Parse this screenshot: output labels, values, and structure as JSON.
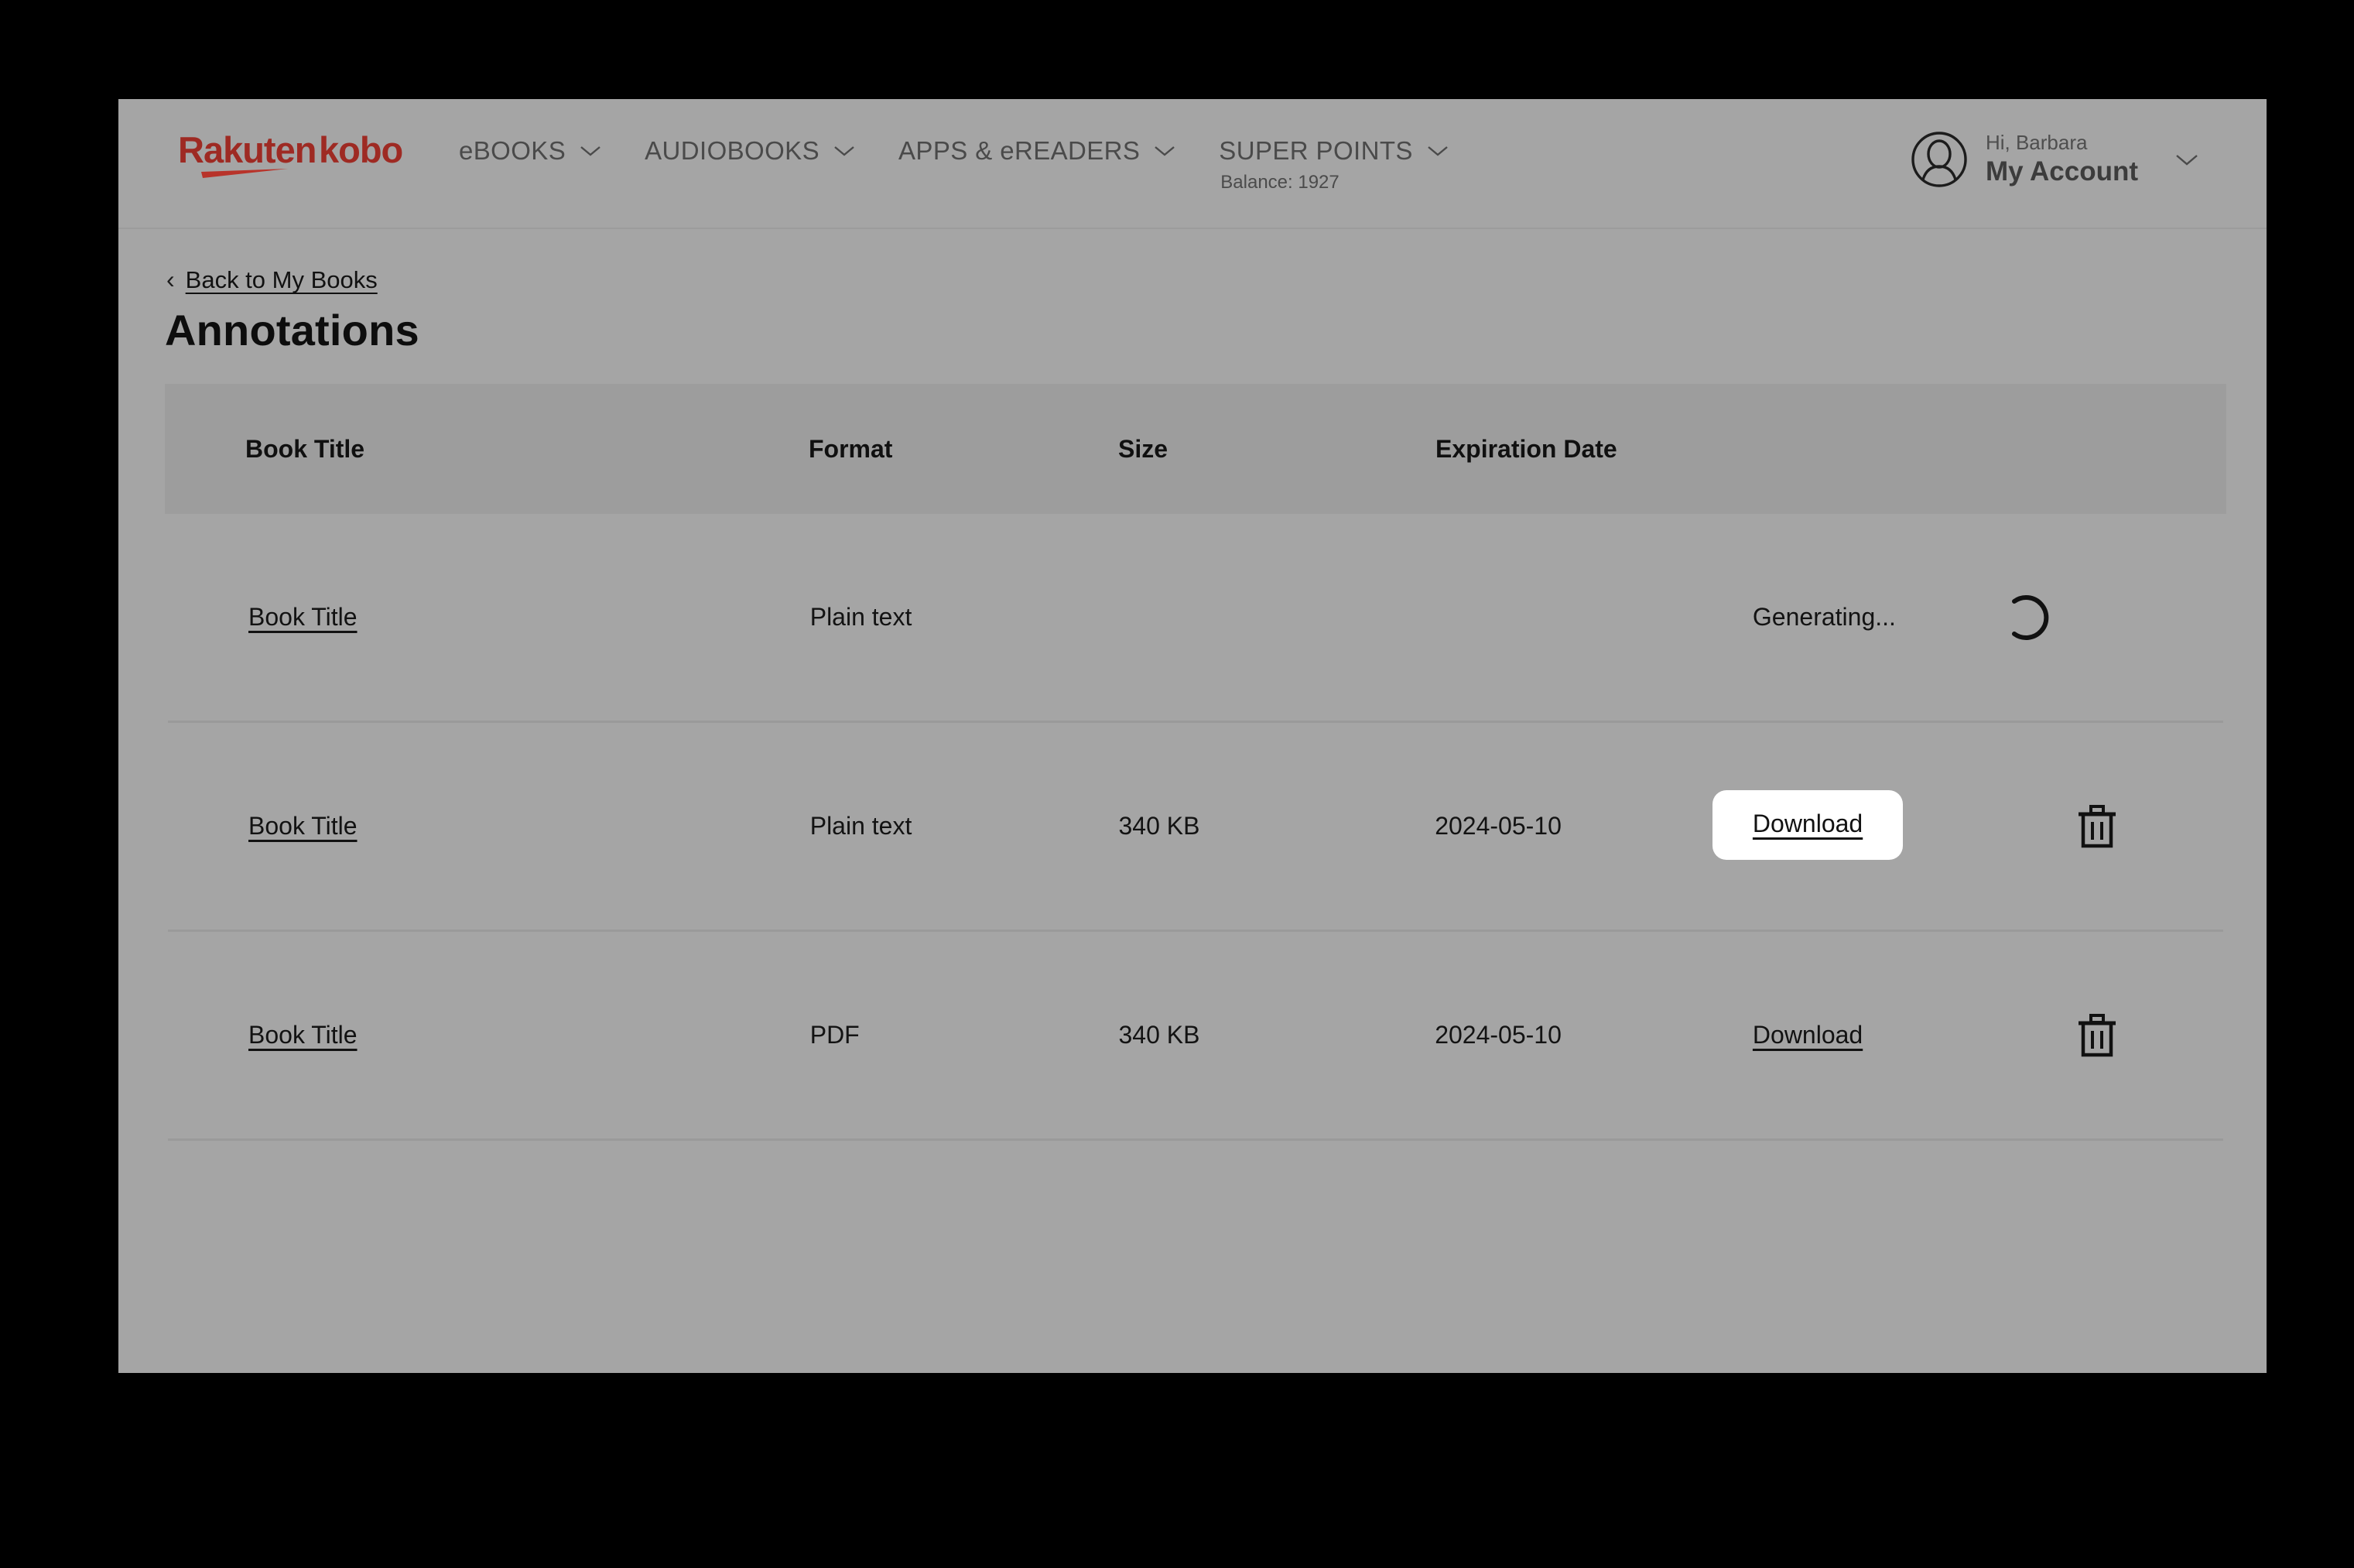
{
  "colors": {
    "page_bg": "#a5a5a5",
    "header_row_bg": "#9d9d9d",
    "logo_red": "#9e2a23",
    "text_dark": "#131313",
    "divider": "#9a9a9a",
    "highlight_bg": "#ffffff",
    "outside_bg": "#000000"
  },
  "header": {
    "logo_text": "Rakuten kobo",
    "logo_icon": "rakuten-kobo-logo",
    "nav": [
      {
        "label": "eBOOKS",
        "icon": "chevron-down-icon",
        "sub": ""
      },
      {
        "label": "AUDIOBOOKS",
        "icon": "chevron-down-icon",
        "sub": ""
      },
      {
        "label": "APPS & eREADERS",
        "icon": "chevron-down-icon",
        "sub": ""
      },
      {
        "label": "SUPER POINTS",
        "icon": "chevron-down-icon",
        "sub": "Balance: 1927"
      }
    ],
    "account": {
      "avatar_icon": "user-avatar-icon",
      "greeting": "Hi, Barbara",
      "name": "My Account",
      "chevron_icon": "chevron-down-icon"
    }
  },
  "main": {
    "breadcrumb": {
      "arrow_icon": "chevron-left-icon",
      "label": "Back to My Books"
    },
    "title": "Annotations",
    "table": {
      "columns": [
        {
          "key": "title",
          "label": "Book Title"
        },
        {
          "key": "format",
          "label": "Format"
        },
        {
          "key": "size",
          "label": "Size"
        },
        {
          "key": "expiration",
          "label": "Expiration Date"
        },
        {
          "key": "action",
          "label": ""
        },
        {
          "key": "delete",
          "label": ""
        }
      ],
      "rows": [
        {
          "title": "Book Title",
          "format": "Plain text",
          "size": "",
          "expiration": "",
          "status": "Generating...",
          "status_icon": "loading-spinner-icon",
          "action": "",
          "delete_icon": "",
          "highlighted": false
        },
        {
          "title": "Book Title",
          "format": "Plain text",
          "size": "340 KB",
          "expiration": "2024-05-10",
          "status": "",
          "status_icon": "",
          "action": "Download",
          "delete_icon": "trash-icon",
          "highlighted": true
        },
        {
          "title": "Book Title",
          "format": "PDF",
          "size": "340 KB",
          "expiration": "2024-05-10",
          "status": "",
          "status_icon": "",
          "action": "Download",
          "delete_icon": "trash-icon",
          "highlighted": false
        }
      ]
    }
  }
}
